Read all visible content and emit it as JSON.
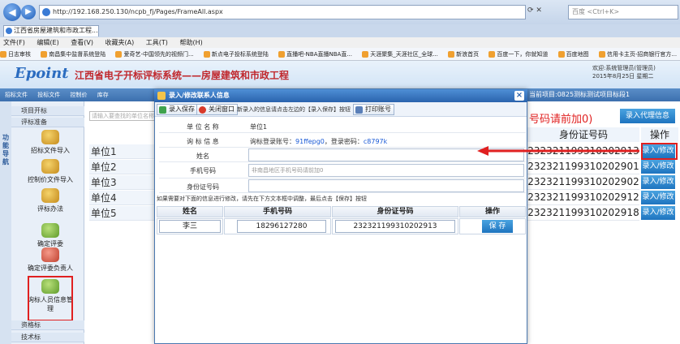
{
  "browser": {
    "url": "http://192.168.250.130/ncpb_fj/Pages/FrameAll.aspx",
    "search_placeholder": "百度 <Ctrl+K>",
    "tab_title": "江西省房屋建筑和市政工程...",
    "menu": [
      "文件(F)",
      "编辑(E)",
      "查看(V)",
      "收藏夹(A)",
      "工具(T)",
      "帮助(H)"
    ],
    "favorites": [
      "日志审核",
      "南昌集中监督系统登陆",
      "爱奇艺-中国领先的视频门...",
      "新点电子投标系统登陆",
      "直播吧-NBA直播NBA直...",
      "天涯聚集_天涯社区_全球...",
      "新浪首页",
      "百度一下，你就知道",
      "百度地图",
      "信用卡主页-招商银行官方..."
    ]
  },
  "header": {
    "logo": "Epoint",
    "title": "江西省电子开标评标系统——房屋建筑和市政工程",
    "welcome": "欢迎:系统管理员(管理员)",
    "date": "2015年8月25日 星期二",
    "nav": [
      "招标文件",
      "投标文件",
      "控制价",
      "库存"
    ],
    "current_project": "当前项目:0825测标测试项目标段1"
  },
  "sidebar": {
    "vertical_label": "功能导航",
    "sections": [
      "项目开标",
      "评标准备"
    ],
    "bottom_sections": [
      "资格标",
      "技术标"
    ],
    "items": [
      "招标文件导入",
      "控制价文件导入",
      "评标办法",
      "确定评委",
      "确定评委负责人",
      "询标人员信息管理"
    ]
  },
  "background": {
    "search_placeholder": "请输入要查找的单位名称",
    "units": [
      "单位1",
      "单位2",
      "单位3",
      "单位4",
      "单位5"
    ],
    "id_header": "身份证号码",
    "op_header": "操作",
    "hint": "号码请前加0)",
    "agent_button": "录入代理信息",
    "ids": [
      "232321199310202913",
      "232321199310202901",
      "232321199310202902",
      "232321199310202912",
      "232321199310202918"
    ],
    "row_button": "录入/修改"
  },
  "modal": {
    "title": "录入/修改联系人信息",
    "close": "×",
    "btn_save": "录入保存",
    "btn_close": "关闭窗口",
    "btn_print": "打印账号",
    "toolbar_hint": "新录入的信息请点击左边的【录入保存】按钮",
    "unit_label": "单 位 名 称",
    "unit_value": "单位1",
    "inquiry_label": "询 标 信 息",
    "inquiry_prefix": "询标登录账号：",
    "account": "91ffepg0",
    "pwd_prefix": "，登录密码：",
    "password": "c8797k",
    "name_label": "姓名",
    "phone_label": "手机号码",
    "phone_placeholder": "非南昌地区手机号码请前加0",
    "id_label": "身份证号码",
    "note": "如果需要对下面的信息进行修改，请先在下方文本框中调整，最后点击【保存】按钮",
    "table": {
      "headers": [
        "姓名",
        "手机号码",
        "身份证号码",
        "操作"
      ],
      "name": "李三",
      "phone": "18296127280",
      "id": "232321199310202913",
      "save": "保 存"
    }
  },
  "colors": {
    "accent": "#1e74bf",
    "highlight": "#e02020",
    "title_red": "#c0282d"
  }
}
